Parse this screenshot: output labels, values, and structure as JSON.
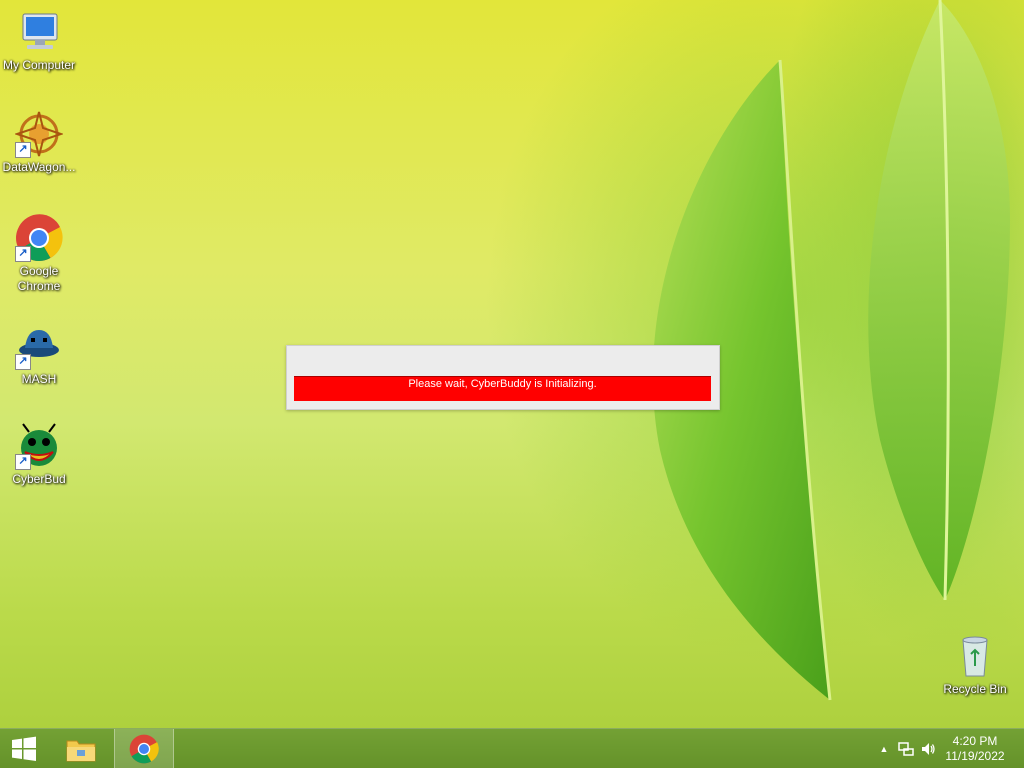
{
  "desktop": {
    "icons": [
      {
        "label": "My Computer",
        "icon": "computer-icon"
      },
      {
        "label": "DataWagon...",
        "icon": "datawagon-icon",
        "shortcut": true
      },
      {
        "label": "Google Chrome",
        "icon": "chrome-icon",
        "shortcut": true
      },
      {
        "label": "MASH",
        "icon": "mash-icon",
        "shortcut": true
      },
      {
        "label": "CyberBud",
        "icon": "cyberbud-icon",
        "shortcut": true
      },
      {
        "label": "Recycle Bin",
        "icon": "recycle-bin-icon"
      }
    ],
    "shortcut_arrow": "↗"
  },
  "dialog": {
    "message": "Please wait, CyberBuddy is Initializing.",
    "bar_color": "#ff0000"
  },
  "taskbar": {
    "start_icon": "windows-logo-icon",
    "pinned": [
      {
        "name": "File Explorer",
        "icon": "file-explorer-icon"
      },
      {
        "name": "Google Chrome",
        "icon": "chrome-icon",
        "active": true
      }
    ],
    "tray": {
      "show_hidden_glyph": "▲",
      "time": "4:20 PM",
      "date": "11/19/2022"
    }
  }
}
